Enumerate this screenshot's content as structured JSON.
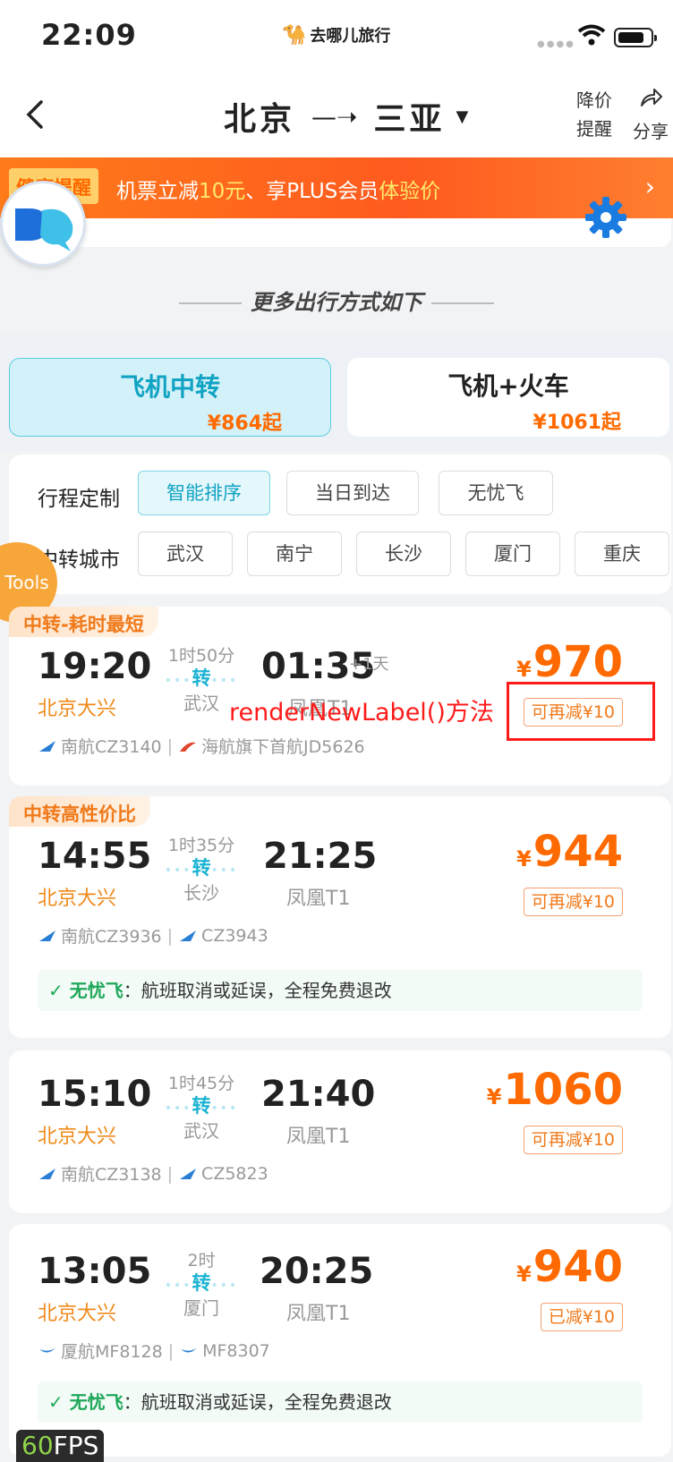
{
  "status": {
    "time": "22:09",
    "brand": "去哪儿旅行"
  },
  "nav": {
    "from": "北京",
    "to": "三亚",
    "price_alert_line1": "降价",
    "price_alert_line2": "提醒",
    "share": "分享"
  },
  "promo": {
    "tag": "健康提醒",
    "text_a": "机票立减",
    "amount": "10元",
    "text_b": "、享PLUS会员",
    "text_c": "体验价"
  },
  "section_title": "更多出行方式如下",
  "modes": [
    {
      "name": "飞机中转",
      "price": "¥864起"
    },
    {
      "name": "飞机+火车",
      "price": "¥1061起"
    }
  ],
  "filters": {
    "trip_label": "行程定制",
    "trip_options": [
      "智能排序",
      "当日到达",
      "无忧飞"
    ],
    "city_label": "中转城市",
    "cities": [
      "武汉",
      "南宁",
      "长沙",
      "厦门",
      "重庆"
    ]
  },
  "tools_label": "Tools",
  "annotation": "renderNewLabel()方法",
  "flights": [
    {
      "badge": "中转-耗时最短",
      "dep_time": "19:20",
      "dep_airport": "北京大兴",
      "duration": "1时50分",
      "transfer": "转",
      "transfer_city": "武汉",
      "arr_time": "01:35",
      "plus_day": "+1天",
      "arr_airport": "凤凰T1",
      "yen": "¥",
      "price": "970",
      "discount": "可再减¥10",
      "airline1": "南航CZ3140",
      "airline2": "海航旗下首航JD5626"
    },
    {
      "badge": "中转高性价比",
      "dep_time": "14:55",
      "dep_airport": "北京大兴",
      "duration": "1时35分",
      "transfer": "转",
      "transfer_city": "长沙",
      "arr_time": "21:25",
      "arr_airport": "凤凰T1",
      "yen": "¥",
      "price": "944",
      "discount": "可再减¥10",
      "airline1": "南航CZ3936",
      "airline2": "CZ3943",
      "worry_title": "无忧飞",
      "worry_text": "：航班取消或延误，全程免费退改"
    },
    {
      "dep_time": "15:10",
      "dep_airport": "北京大兴",
      "duration": "1时45分",
      "transfer": "转",
      "transfer_city": "武汉",
      "arr_time": "21:40",
      "arr_airport": "凤凰T1",
      "yen": "¥",
      "price": "1060",
      "discount": "可再减¥10",
      "airline1": "南航CZ3138",
      "airline2": "CZ5823"
    },
    {
      "dep_time": "13:05",
      "dep_airport": "北京大兴",
      "duration": "2时",
      "transfer": "转",
      "transfer_city": "厦门",
      "arr_time": "20:25",
      "arr_airport": "凤凰T1",
      "yen": "¥",
      "price": "940",
      "discount": "已减¥10",
      "airline1": "厦航MF8128",
      "airline2": "MF8307",
      "worry_title": "无忧飞",
      "worry_text": "：航班取消或延误，全程免费退改"
    }
  ],
  "fps": {
    "value": "60",
    "unit": "FPS"
  }
}
